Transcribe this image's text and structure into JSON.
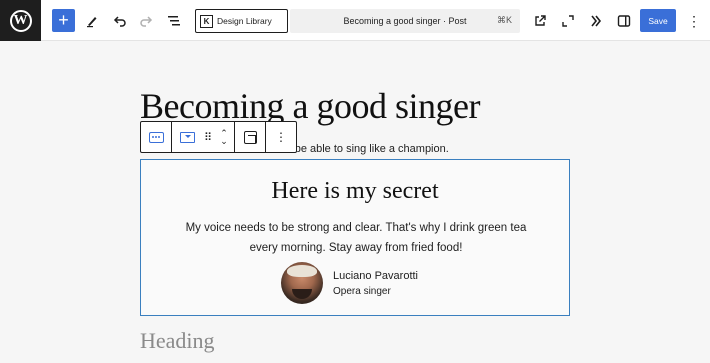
{
  "topbar": {
    "logo_icon": "wordpress-logo-icon",
    "inserter_icon": "plus-icon",
    "tools_icon": "pencil-icon",
    "undo_icon": "undo-icon",
    "redo_icon": "redo-icon",
    "outline_icon": "document-outline-icon",
    "design_library_label": "Design Library",
    "command_bar_title": "Becoming a good singer · Post",
    "command_bar_shortcut": "⌘K",
    "view_icon": "external-view-icon",
    "preview_icon": "preview-icon",
    "plugin_icon": "plugin-icon",
    "sidebar_icon": "sidebar-toggle-icon",
    "save_label": "Save",
    "options_icon": "more-vertical-icon"
  },
  "editor": {
    "post_title": "Becoming a good singer",
    "intro_paragraph_visible": "to be able to sing like a champion.",
    "block_toolbar": {
      "parent_icon": "select-parent-icon",
      "block_type_icon": "group-block-icon",
      "drag_icon": "drag-handle-icon",
      "move_up_icon": "chevron-up-icon",
      "move_down_icon": "chevron-down-icon",
      "align_icon": "align-icon",
      "more_icon": "more-vertical-icon"
    },
    "group": {
      "heading": "Here is my secret",
      "body": "My voice needs to be strong and clear. That's why I drink green tea every morning. Stay away from fried food!",
      "author_name": "Luciano Pavarotti",
      "author_role": "Opera singer"
    },
    "next_heading_placeholder": "Heading"
  },
  "colors": {
    "accent": "#3a6fd8",
    "selection_border": "#3a7fbf",
    "topbar_dark": "#1e1e1e"
  }
}
